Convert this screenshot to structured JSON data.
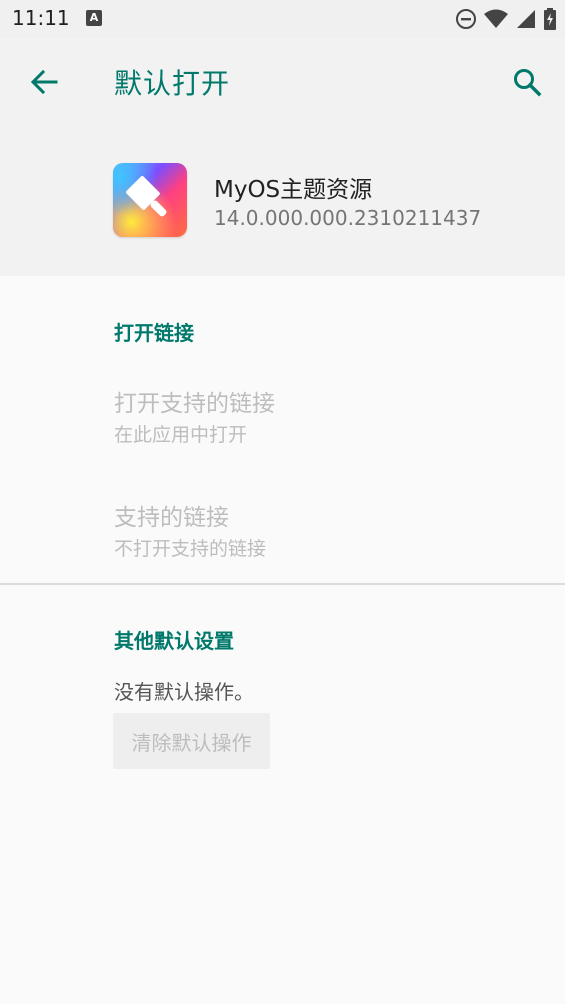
{
  "status_bar": {
    "time": "11:11",
    "notification_icon_letter": "A",
    "icons": [
      "dnd-icon",
      "wifi-icon",
      "signal-icon",
      "battery-icon"
    ]
  },
  "app_bar": {
    "title": "默认打开",
    "back_icon": "arrow-back-icon",
    "search_icon": "search-icon"
  },
  "app_info": {
    "name": "MyOS主题资源",
    "version": "14.0.000.000.2310211437"
  },
  "open_links": {
    "header": "打开链接",
    "items": [
      {
        "title": "打开支持的链接",
        "summary": "在此应用中打开"
      },
      {
        "title": "支持的链接",
        "summary": "不打开支持的链接"
      }
    ]
  },
  "other_defaults": {
    "header": "其他默认设置",
    "message": "没有默认操作。",
    "clear_button": "清除默认操作"
  },
  "colors": {
    "accent": "#00796b",
    "disabled_text": "#bdbdbd",
    "background": "#fafafa",
    "header_background": "#f2f2f2"
  }
}
